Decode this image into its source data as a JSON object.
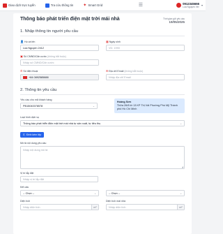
{
  "topbar": {
    "items": [
      {
        "label": "Giao dịch trực tuyến",
        "icon": "document-icon"
      },
      {
        "label": "Tra cứu thông tin",
        "icon": "search-list-icon"
      },
      {
        "label": "Smart Grid",
        "icon": "star-icon"
      }
    ],
    "menu_icon": "hamburger-icon",
    "user": {
      "phone": "0912345666",
      "name": "Lùa Nguyen Ver"
    }
  },
  "page": {
    "title": "Thông báo phát triển điện mặt trời mái nhà",
    "sent_label": "Thời gian gửi yêu cầu",
    "sent_date": "19/05/2025"
  },
  "section1": {
    "title": "1. Nhập thông tin người yêu cầu",
    "fields": {
      "name": {
        "label": "Họ và tên",
        "value": "Lùa Nguyen 2412"
      },
      "dob": {
        "label": "Ngày sinh",
        "placeholder": "VD: 1990"
      },
      "id": {
        "label": "Số CMND/Căn cước",
        "optional": "(không bắt buộc)",
        "placeholder": "Nhập số CMND/Căn cước"
      },
      "phone": {
        "label": "Số điện thoại",
        "value": "+84 0892585888"
      },
      "email": {
        "label": "Địa chỉ Email",
        "optional": "(không bắt buộc)",
        "placeholder": "Nhập địa chỉ Email"
      }
    }
  },
  "section2": {
    "title": "2. Thông tin yêu cầu",
    "customer_code": {
      "label": "Yêu cầu cho mã khách hàng",
      "value": "PB15040078578"
    },
    "customer_info": {
      "name": "Hoàng Sơn",
      "address": "Thửa 26/8 tờ 13 KP Thị Vải Phường Phú Mỹ Thành phố Hồ Chí Minh"
    },
    "request_type": {
      "label": "Loại hình dịch vụ",
      "value": "Thông báo phát triển điện mặt trời mái nhà tự sản xuất, tự tiêu thụ"
    },
    "upload_button": "Đính kèm tệp",
    "description": {
      "label": "Mô tả nội dung yêu cầu",
      "placeholder": "Nhập nội dung mô tả"
    },
    "location": {
      "label": "Vị trí lắp đặt",
      "placeholder": "Nhập vị trí lắp đặt"
    },
    "roof": {
      "label": "Kết cấu",
      "option1": "-- Chọn --",
      "option2": "-- Chọn --"
    },
    "area": {
      "label": "Diện tích",
      "placeholder": "Nhập diện tích",
      "unit": "m²"
    },
    "capacity": {
      "label": "Diện tích mái nhà",
      "placeholder": "Nhập diện tích",
      "unit": "m²"
    }
  }
}
